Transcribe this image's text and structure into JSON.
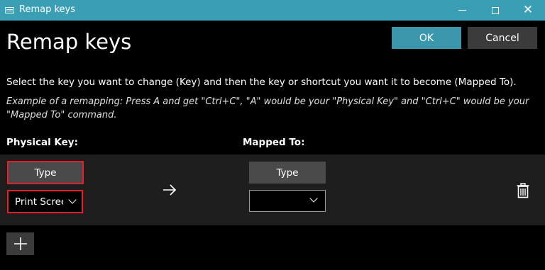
{
  "window": {
    "title": "Remap keys",
    "controls": {
      "minimize": "minimize-icon",
      "maximize": "maximize-icon",
      "close": "close-icon"
    }
  },
  "header": {
    "heading": "Remap keys",
    "ok_label": "OK",
    "cancel_label": "Cancel"
  },
  "instructions": {
    "main": "Select the key you want to change (Key) and then the key or shortcut you want it to become (Mapped To).",
    "example": "Example of a remapping: Press A and get \"Ctrl+C\", \"A\" would be your \"Physical Key\" and \"Ctrl+C\" would be your \"Mapped To\" command."
  },
  "columns": {
    "physical": "Physical Key:",
    "mapped": "Mapped To:"
  },
  "mapping_row": {
    "physical_type_label": "Type",
    "physical_selected": "Print Scree",
    "mapped_type_label": "Type",
    "mapped_selected": ""
  },
  "colors": {
    "titlebar": "#3a9fb4",
    "accent_button": "#3a97ac",
    "highlight_border": "#e0202c",
    "panel": "#1e1e1e"
  }
}
